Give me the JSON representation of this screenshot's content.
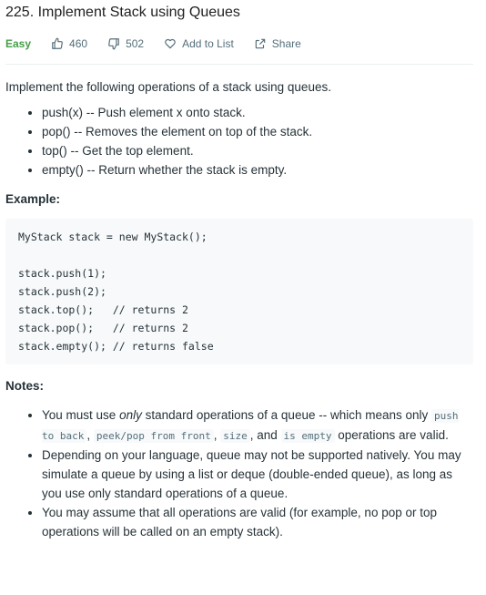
{
  "title": "225. Implement Stack using Queues",
  "meta": {
    "difficulty": "Easy",
    "likes": "460",
    "dislikes": "502",
    "add_to_list": "Add to List",
    "share": "Share"
  },
  "intro": "Implement the following operations of a stack using queues.",
  "operations": [
    "push(x) -- Push element x onto stack.",
    "pop() -- Removes the element on top of the stack.",
    "top() -- Get the top element.",
    "empty() -- Return whether the stack is empty."
  ],
  "example_label": "Example:",
  "example_code": [
    "MyStack stack = new MyStack();",
    "",
    "stack.push(1);",
    "stack.push(2);",
    "stack.top();   // returns 2",
    "stack.pop();   // returns 2",
    "stack.empty(); // returns false"
  ],
  "notes_label": "Notes:",
  "notes": {
    "n1": {
      "a": "You must use ",
      "only": "only",
      "b": " standard operations of a queue -- which means only ",
      "c1": "push to back",
      "s1": ", ",
      "c2": "peek/pop from front",
      "s2": ", ",
      "c3": "size",
      "s3": ", and ",
      "c4": "is empty",
      "d": " operations are valid."
    },
    "n2": "Depending on your language, queue may not be supported natively. You may simulate a queue by using a list or deque (double-ended queue), as long as you use only standard operations of a queue.",
    "n3": "You may assume that all operations are valid (for example, no pop or top operations will be called on an empty stack)."
  },
  "colors": {
    "easy": "#43a047",
    "muted": "#546e7a",
    "code_bg": "#f7f9fa"
  }
}
